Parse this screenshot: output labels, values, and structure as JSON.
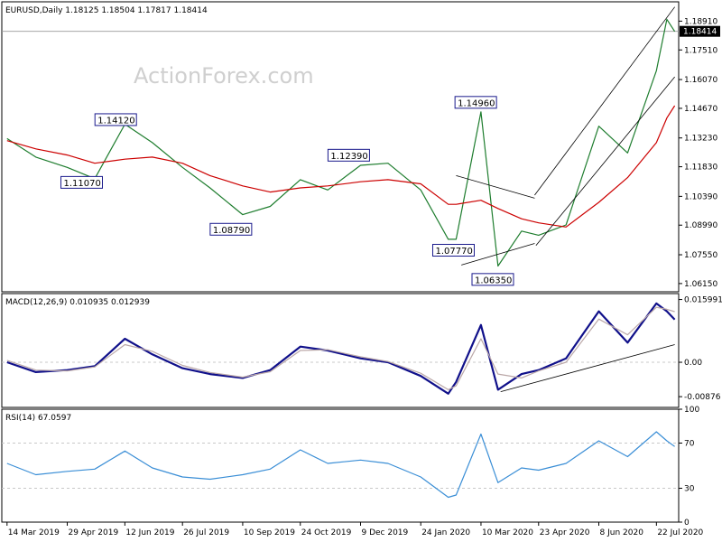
{
  "colors": {
    "price": "#1e7d2e",
    "ma": "#cc0000",
    "macd_line": "#10108a",
    "macd_signal": "#bba8a8",
    "rsi": "#3a8ed6",
    "trendline": "#000000",
    "grid": "#c8c8c8"
  },
  "chart_data": [
    {
      "type": "line",
      "panel": "price",
      "title": "EURUSD,Daily  1.18125 1.18504 1.17817 1.18414",
      "watermark": "ActionForex.com",
      "ylim": [
        1.0575,
        1.1985
      ],
      "yticks": [
        "1.18910",
        "1.17510",
        "1.16070",
        "1.14670",
        "1.13230",
        "1.11830",
        "1.10390",
        "1.08990",
        "1.07550",
        "1.06150"
      ],
      "current_price": "1.18414",
      "x": [
        "2019-03-14",
        "2019-04-05",
        "2019-04-29",
        "2019-05-20",
        "2019-06-12",
        "2019-07-03",
        "2019-07-26",
        "2019-08-16",
        "2019-09-10",
        "2019-10-01",
        "2019-10-24",
        "2019-11-14",
        "2019-12-09",
        "2019-12-30",
        "2020-01-24",
        "2020-02-14",
        "2020-02-20",
        "2020-03-10",
        "2020-03-23",
        "2020-04-10",
        "2020-04-23",
        "2020-05-14",
        "2020-06-08",
        "2020-06-30",
        "2020-07-22",
        "2020-07-30",
        "2020-08-05"
      ],
      "series": [
        {
          "values": [
            1.132,
            1.123,
            1.118,
            1.1125,
            1.139,
            1.13,
            1.118,
            1.108,
            1.095,
            1.099,
            1.112,
            1.107,
            1.119,
            1.12,
            1.107,
            1.083,
            1.083,
            1.145,
            1.07,
            1.087,
            1.085,
            1.09,
            1.138,
            1.125,
            1.165,
            1.19,
            1.1841
          ]
        },
        {
          "values": [
            1.131,
            1.127,
            1.124,
            1.12,
            1.122,
            1.123,
            1.12,
            1.114,
            1.109,
            1.106,
            1.108,
            1.109,
            1.111,
            1.112,
            1.11,
            1.1,
            1.1,
            1.102,
            1.098,
            1.093,
            1.091,
            1.089,
            1.101,
            1.113,
            1.13,
            1.142,
            1.148
          ]
        }
      ],
      "labels": [
        {
          "text": "1.14120",
          "x": "2019-06-05"
        },
        {
          "text": "1.11070",
          "x": "2019-05-10"
        },
        {
          "text": "1.08790",
          "x": "2019-09-01"
        },
        {
          "text": "1.12390",
          "x": "2019-11-30"
        },
        {
          "text": "1.14960",
          "x": "2020-03-06"
        },
        {
          "text": "1.07770",
          "x": "2020-02-18"
        },
        {
          "text": "1.06350",
          "x": "2020-03-19"
        }
      ]
    },
    {
      "type": "line",
      "panel": "macd",
      "title": "MACD(12,26,9) 0.010935 0.012939",
      "ylim": [
        -0.0115,
        0.0175
      ],
      "yticks": [
        "0.015991",
        "0.00",
        "-0.00876"
      ],
      "x": [
        "2019-03-14",
        "2019-04-05",
        "2019-04-29",
        "2019-05-20",
        "2019-06-12",
        "2019-07-03",
        "2019-07-26",
        "2019-08-16",
        "2019-09-10",
        "2019-10-01",
        "2019-10-24",
        "2019-11-14",
        "2019-12-09",
        "2019-12-30",
        "2020-01-24",
        "2020-02-14",
        "2020-02-20",
        "2020-03-10",
        "2020-03-23",
        "2020-04-10",
        "2020-04-23",
        "2020-05-14",
        "2020-06-08",
        "2020-06-30",
        "2020-07-22",
        "2020-07-30",
        "2020-08-05"
      ],
      "series": [
        {
          "values": [
            0.0,
            -0.0025,
            -0.002,
            -0.001,
            0.006,
            0.002,
            -0.0015,
            -0.003,
            -0.004,
            -0.002,
            0.004,
            0.003,
            0.001,
            0.0,
            -0.0035,
            -0.008,
            -0.005,
            0.0095,
            -0.007,
            -0.003,
            -0.002,
            0.001,
            0.013,
            0.005,
            0.015,
            0.013,
            0.0109
          ]
        },
        {
          "values": [
            0.0005,
            -0.002,
            -0.0022,
            -0.0012,
            0.0045,
            0.0028,
            -0.0008,
            -0.0026,
            -0.0038,
            -0.0024,
            0.003,
            0.0032,
            0.0014,
            0.0002,
            -0.0028,
            -0.007,
            -0.006,
            0.006,
            -0.003,
            -0.004,
            -0.0022,
            0.0,
            0.011,
            0.007,
            0.014,
            0.0135,
            0.0129
          ]
        }
      ]
    },
    {
      "type": "line",
      "panel": "rsi",
      "title": "RSI(14) 67.0597",
      "ylim": [
        0,
        100
      ],
      "yticks": [
        "100",
        "70",
        "30",
        "0"
      ],
      "x": [
        "2019-03-14",
        "2019-04-05",
        "2019-04-29",
        "2019-05-20",
        "2019-06-12",
        "2019-07-03",
        "2019-07-26",
        "2019-08-16",
        "2019-09-10",
        "2019-10-01",
        "2019-10-24",
        "2019-11-14",
        "2019-12-09",
        "2019-12-30",
        "2020-01-24",
        "2020-02-14",
        "2020-02-20",
        "2020-03-10",
        "2020-03-23",
        "2020-04-10",
        "2020-04-23",
        "2020-05-14",
        "2020-06-08",
        "2020-06-30",
        "2020-07-22",
        "2020-07-30",
        "2020-08-05"
      ],
      "series": [
        {
          "values": [
            52,
            42,
            45,
            47,
            63,
            48,
            40,
            38,
            42,
            47,
            64,
            52,
            55,
            52,
            40,
            22,
            24,
            78,
            35,
            48,
            46,
            52,
            72,
            58,
            80,
            72,
            67
          ]
        }
      ]
    }
  ],
  "x_axis_labels": [
    {
      "text": "14 Mar 2019",
      "x": "2019-03-14"
    },
    {
      "text": "29 Apr 2019",
      "x": "2019-04-29"
    },
    {
      "text": "12 Jun 2019",
      "x": "2019-06-12"
    },
    {
      "text": "26 Jul 2019",
      "x": "2019-07-26"
    },
    {
      "text": "10 Sep 2019",
      "x": "2019-09-10"
    },
    {
      "text": "24 Oct 2019",
      "x": "2019-10-24"
    },
    {
      "text": "9 Dec 2019",
      "x": "2019-12-09"
    },
    {
      "text": "24 Jan 2020",
      "x": "2020-01-24"
    },
    {
      "text": "10 Mar 2020",
      "x": "2020-03-10"
    },
    {
      "text": "23 Apr 2020",
      "x": "2020-04-23"
    },
    {
      "text": "8 Jun 2020",
      "x": "2020-06-08"
    },
    {
      "text": "22 Jul 2020",
      "x": "2020-07-22"
    }
  ],
  "trendlines": [
    {
      "panel": "price",
      "x": [
        "2020-04-20",
        "2020-08-05"
      ],
      "y": [
        1.1045,
        1.196
      ]
    },
    {
      "panel": "price",
      "x": [
        "2020-04-21",
        "2020-08-05"
      ],
      "y": [
        1.08,
        1.162
      ]
    },
    {
      "panel": "price",
      "x": [
        "2020-02-20",
        "2020-04-20"
      ],
      "y": [
        1.114,
        1.103
      ]
    },
    {
      "panel": "price",
      "x": [
        "2020-02-24",
        "2020-04-20"
      ],
      "y": [
        1.0705,
        1.081
      ]
    },
    {
      "panel": "macd",
      "x": [
        "2020-03-25",
        "2020-08-05"
      ],
      "y": [
        -0.0075,
        0.0045
      ]
    }
  ]
}
